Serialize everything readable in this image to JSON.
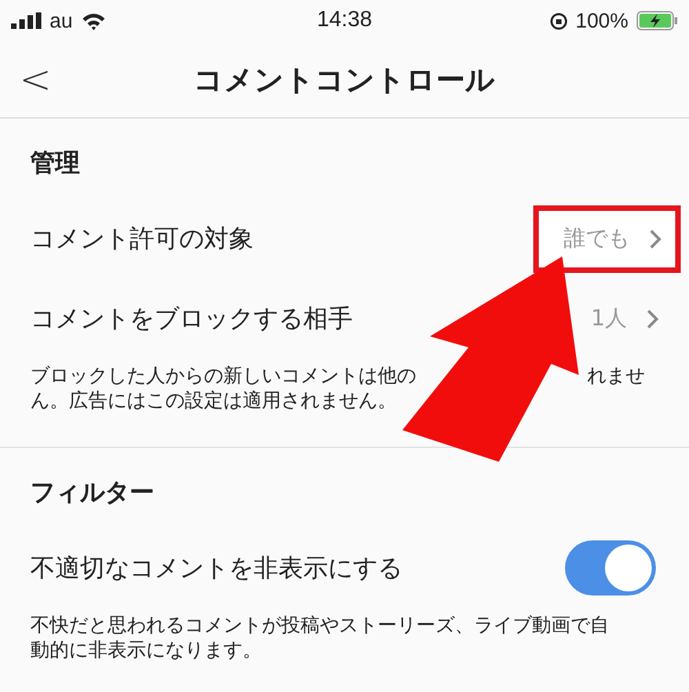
{
  "status_bar": {
    "carrier": "au",
    "time": "14:38",
    "battery": "100%"
  },
  "nav": {
    "back": "<",
    "title": "コメントコントロール"
  },
  "sections": [
    {
      "header": "管理",
      "rows": [
        {
          "kind": "link",
          "label": "コメント許可の対象",
          "value": "誰でも",
          "highlighted": true
        },
        {
          "kind": "link",
          "label": "コメントをブロックする相手",
          "value": "1人",
          "highlighted": false
        }
      ],
      "note": {
        "line1_start": "ブロックした人からの新しいコメントは他の",
        "line1_end": "れませ",
        "line2": "ん。広告にはこの設定は適用されません。"
      }
    },
    {
      "header": "フィルター",
      "rows": [
        {
          "kind": "toggle",
          "label": "不適切なコメントを非表示にする",
          "on": true
        }
      ],
      "note": {
        "line1_start": "不快だと思われるコメントが投稿やストーリーズ、ライブ動画で自",
        "line2": "動的に非表示になります。"
      }
    }
  ]
}
